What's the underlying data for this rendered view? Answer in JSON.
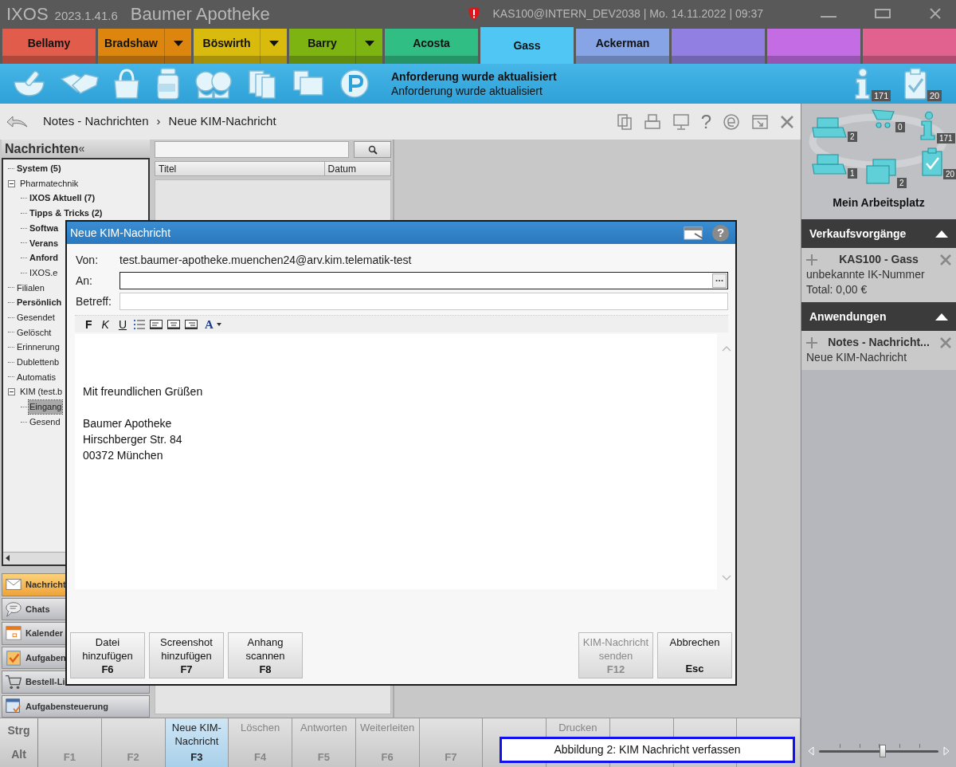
{
  "title_bar": {
    "app": "IXOS",
    "version": "2023.1.41.6",
    "pharmacy": "Baumer Apotheke",
    "status": "KAS100@INTERN_DEV2038  |  Mo. 14.11.2022  |  09:37"
  },
  "tabs": [
    {
      "label": "Bellamy",
      "color": "#e25c4c",
      "dropdown": false,
      "selected": false
    },
    {
      "label": "Bradshaw",
      "color": "#dc860f",
      "dropdown": true,
      "selected": false
    },
    {
      "label": "Böswirth",
      "color": "#d8bb0c",
      "dropdown": true,
      "selected": false
    },
    {
      "label": "Barry",
      "color": "#7db412",
      "dropdown": true,
      "selected": false
    },
    {
      "label": "Acosta",
      "color": "#31be85",
      "dropdown": false,
      "selected": false
    },
    {
      "label": "Gass",
      "color": "#4fc6f4",
      "dropdown": false,
      "selected": true
    },
    {
      "label": "Ackerman",
      "color": "#87a5e6",
      "dropdown": false,
      "selected": false
    },
    {
      "color": "#9180e2",
      "dropdown": false,
      "selected": false
    },
    {
      "color": "#c36ce4",
      "dropdown": false,
      "selected": false
    },
    {
      "color": "#e2628f",
      "dropdown": false,
      "selected": false
    }
  ],
  "toolbar": {
    "message_title": "Anforderung wurde aktualisiert",
    "message_text": "Anforderung wurde aktualisiert",
    "info_count": "171",
    "tasks_count": "20"
  },
  "breadcrumb": {
    "items": [
      "Notes - Nachrichten",
      "Neue KIM-Nachricht"
    ],
    "separator": "›",
    "help": "?"
  },
  "sidebar": {
    "title": "Nachrichten",
    "collapse": "«",
    "tree": [
      {
        "label": "System (5)",
        "bold": true,
        "selected": false
      },
      {
        "label": "Pharmatechnik",
        "bold": false,
        "selected": false,
        "expanded": true,
        "children": [
          {
            "label": "IXOS Aktuell (7)",
            "bold": true,
            "selected": false
          },
          {
            "label": "Tipps & Tricks (2)",
            "bold": true,
            "selected": false
          },
          {
            "label": "Softwa",
            "bold": true,
            "selected": false
          },
          {
            "label": "Verans",
            "bold": true,
            "selected": false
          },
          {
            "label": "Anford",
            "bold": true,
            "selected": false
          },
          {
            "label": "IXOS.e",
            "bold": false,
            "selected": false
          }
        ]
      },
      {
        "label": "Filialen",
        "bold": false,
        "selected": false
      },
      {
        "label": "Persönlich",
        "bold": true,
        "selected": false
      },
      {
        "label": "Gesendet",
        "bold": false,
        "selected": false
      },
      {
        "label": "Gelöscht",
        "bold": false,
        "selected": false
      },
      {
        "label": "Erinnerung",
        "bold": false,
        "selected": false
      },
      {
        "label": "Dublettenb",
        "bold": false,
        "selected": false
      },
      {
        "label": "Automatis",
        "bold": false,
        "selected": false
      },
      {
        "label": "KIM (test.b",
        "bold": false,
        "selected": false,
        "expanded": true,
        "children": [
          {
            "label": "Eingang",
            "bold": false,
            "selected": true
          },
          {
            "label": "Gesend",
            "bold": false,
            "selected": false
          }
        ]
      }
    ],
    "nav": [
      {
        "label": "Nachricht",
        "kind": "mail",
        "selected": true
      },
      {
        "label": "Chats",
        "kind": "chat",
        "selected": false
      },
      {
        "label": "Kalender",
        "kind": "calendar",
        "selected": false
      },
      {
        "label": "Aufgaben",
        "kind": "tasks",
        "selected": false
      },
      {
        "label": "Bestell-Li",
        "kind": "cart",
        "selected": false
      },
      {
        "label": "Aufgabensteuerung",
        "kind": "control",
        "selected": false
      }
    ]
  },
  "message_list": {
    "columns": [
      "Titel",
      "Datum"
    ]
  },
  "dialog": {
    "title": "Neue KIM-Nachricht",
    "help": "?",
    "fields": [
      {
        "label": "Von:",
        "kind": "static",
        "value": "test.baumer-apotheke.muenchen24@arv.kim.telematik-test"
      },
      {
        "label": "An:",
        "kind": "input",
        "focused": true,
        "browse": true
      },
      {
        "label": "Betreff:",
        "kind": "input",
        "focused": false,
        "browse": false
      }
    ],
    "format_buttons": [
      {
        "label": "F",
        "kind": "bold"
      },
      {
        "label": "K",
        "kind": "italic"
      },
      {
        "label": "U",
        "kind": "underline"
      }
    ],
    "font_color_label": "A",
    "greeting": "Mit freundlichen Grüßen",
    "signature": [
      "Baumer Apotheke",
      "Hirschberger Str. 84",
      "00372 München"
    ],
    "left_buttons": [
      {
        "label": "Datei hinzufügen",
        "key": "F6",
        "disabled": false
      },
      {
        "label": "Screenshot hinzufügen",
        "key": "F7",
        "disabled": false
      },
      {
        "label": "Anhang scannen",
        "key": "F8",
        "disabled": false
      }
    ],
    "right_buttons": [
      {
        "label": "KIM-Nachricht senden",
        "key": "F12",
        "disabled": true
      },
      {
        "label": "Abbrechen",
        "key": "Esc",
        "disabled": false
      }
    ]
  },
  "function_keys": {
    "modifiers": [
      "Strg",
      "Alt"
    ],
    "keys": [
      {
        "key": "F1",
        "disabled": true,
        "selected": false
      },
      {
        "key": "F2",
        "disabled": true,
        "selected": false
      },
      {
        "label": "Neue KIM-Nachricht",
        "key": "F3",
        "disabled": false,
        "selected": true
      },
      {
        "label": "Löschen",
        "key": "F4",
        "disabled": true,
        "selected": false
      },
      {
        "label": "Antworten",
        "key": "F5",
        "disabled": true,
        "selected": false
      },
      {
        "label": "Weiterleiten",
        "key": "F6",
        "disabled": true,
        "selected": false
      },
      {
        "key": "F7",
        "disabled": true,
        "selected": false
      },
      {
        "selected": false
      },
      {
        "label": "Drucken",
        "disabled": true,
        "selected": false
      },
      {
        "selected": false
      },
      {
        "selected": false
      },
      {
        "selected": false
      }
    ]
  },
  "right_panel": {
    "workplace": {
      "title": "Mein Arbeitsplatz",
      "counts": [
        "2",
        "0",
        "171",
        "1",
        "2",
        "20"
      ]
    },
    "sections": [
      {
        "title": "Verkaufsvorgänge",
        "expanded": true,
        "items": [
          {
            "title": "KAS100 - Gass",
            "lines": [
              "unbekannte IK-Nummer",
              "Total: 0,00 €"
            ]
          }
        ]
      },
      {
        "title": "Anwendungen",
        "expanded": true,
        "items": [
          {
            "title": "Notes - Nachricht...",
            "lines": [
              "Neue KIM-Nachricht"
            ]
          }
        ]
      }
    ],
    "zoom": {
      "level": 0.53
    }
  },
  "caption": "Abbildung 2: KIM Nachricht verfassen"
}
